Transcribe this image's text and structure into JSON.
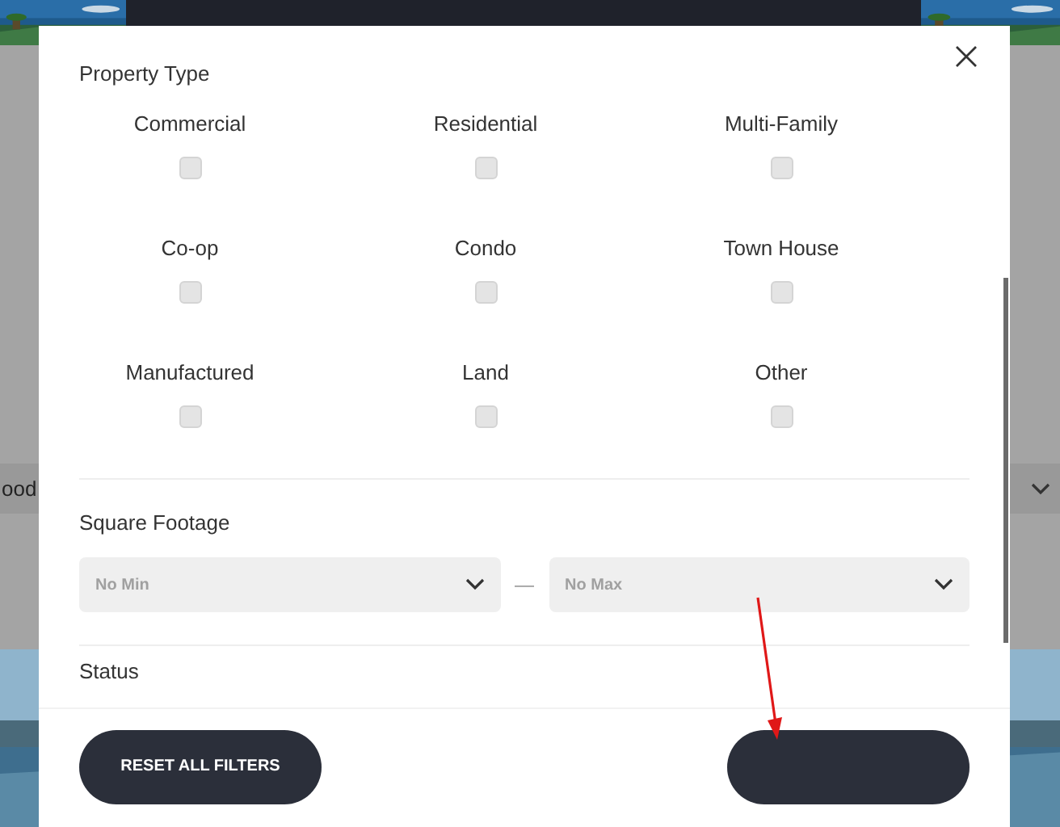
{
  "background": {
    "dropdown_text": "ood"
  },
  "property_type": {
    "title": "Property Type",
    "options": [
      {
        "label": "Commercial",
        "checked": false
      },
      {
        "label": "Residential",
        "checked": false
      },
      {
        "label": "Multi-Family",
        "checked": false
      },
      {
        "label": "Co-op",
        "checked": false
      },
      {
        "label": "Condo",
        "checked": false
      },
      {
        "label": "Town House",
        "checked": false
      },
      {
        "label": "Manufactured",
        "checked": false
      },
      {
        "label": "Land",
        "checked": false
      },
      {
        "label": "Other",
        "checked": false
      }
    ]
  },
  "square_footage": {
    "title": "Square Footage",
    "min": {
      "value": "No Min"
    },
    "separator": "—",
    "max": {
      "value": "No Max"
    }
  },
  "status": {
    "title": "Status"
  },
  "footer": {
    "reset_button": "RESET ALL FILTERS"
  }
}
